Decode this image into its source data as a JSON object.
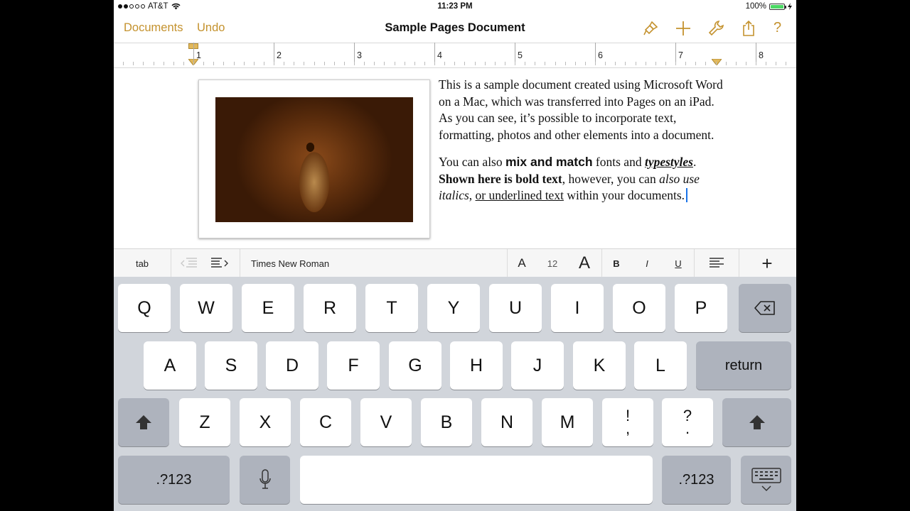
{
  "status_bar": {
    "carrier": "AT&T",
    "time": "11:23 PM",
    "battery_percent": "100%",
    "battery_level": 1.0
  },
  "navbar": {
    "left_buttons": [
      "Documents",
      "Undo"
    ],
    "title": "Sample Pages Document",
    "accent_color": "#c4922e",
    "icons": [
      "paintbrush-icon",
      "plus-icon",
      "wrench-icon",
      "share-icon",
      "help-icon"
    ],
    "help_label": "?"
  },
  "ruler": {
    "numbers": [
      "1",
      "2",
      "3",
      "4",
      "5",
      "6",
      "7",
      "8"
    ]
  },
  "document": {
    "paragraph1": "This is a sample document created using Microsoft Word on a Mac, which was transferred into Pages on an iPad. As you can see, it’s possible to incorporate text, formatting, photos and other elements into a document.",
    "p2_a": "You can also ",
    "p2_b": "mix and match",
    "p2_c": " fonts and ",
    "p2_d": "typestyles",
    "p2_e": ". ",
    "p2_f": "Shown here is bold text",
    "p2_g": ", however, you can ",
    "p2_h": "also use italics",
    "p2_i": ", ",
    "p2_j": "or underlined text",
    "p2_k": " within your documents."
  },
  "format_bar": {
    "tab": "tab",
    "font": "Times New Roman",
    "font_small": "A",
    "font_size": "12",
    "font_large": "A",
    "bold": "B",
    "italic": "I",
    "underline": "U",
    "insert": "+"
  },
  "keyboard": {
    "row1": [
      "Q",
      "W",
      "E",
      "R",
      "T",
      "Y",
      "U",
      "I",
      "O",
      "P"
    ],
    "row2": [
      "A",
      "S",
      "D",
      "F",
      "G",
      "H",
      "J",
      "K",
      "L"
    ],
    "return": "return",
    "row3": [
      "Z",
      "X",
      "C",
      "V",
      "B",
      "N",
      "M"
    ],
    "punct1": [
      "!",
      ","
    ],
    "punct2": [
      "?",
      "."
    ],
    "numbers_key": ".?123"
  }
}
